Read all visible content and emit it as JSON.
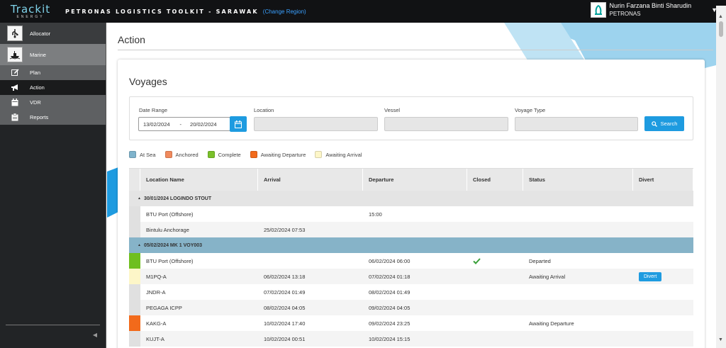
{
  "header": {
    "logo_main": "Trackit",
    "logo_sub": "ENERGY",
    "app_title": "PETRONAS LOGISTICS TOOLKIT - SARAWAK",
    "change_region": "(Change Region)",
    "user_name": "Nurin Farzana Binti Sharudin",
    "user_org": "PETRONAS"
  },
  "sidebar": {
    "items": [
      {
        "label": "Allocator",
        "icon": "usb-icon"
      },
      {
        "label": "Marine",
        "icon": "ship-icon"
      },
      {
        "label": "Plan",
        "icon": "edit-icon"
      },
      {
        "label": "Action",
        "icon": "megaphone-icon"
      },
      {
        "label": "VDR",
        "icon": "calendar-icon"
      },
      {
        "label": "Reports",
        "icon": "clipboard-icon"
      }
    ]
  },
  "page": {
    "title": "Action",
    "card_title": "Voyages"
  },
  "filters": {
    "date_range_label": "Date Range",
    "date_from": "13/02/2024",
    "date_sep": "-",
    "date_to": "20/02/2024",
    "location_label": "Location",
    "location_value": "",
    "vessel_label": "Vessel",
    "vessel_value": "",
    "voyage_type_label": "Voyage Type",
    "voyage_type_value": "",
    "search_label": "Search"
  },
  "legend": [
    {
      "label": "At Sea",
      "color": "#7fb3cc"
    },
    {
      "label": "Anchored",
      "color": "#f08a5d"
    },
    {
      "label": "Complete",
      "color": "#7ac02a"
    },
    {
      "label": "Awaiting Departure",
      "color": "#f26a1b"
    },
    {
      "label": "Awaiting Arrival",
      "color": "#fdf6c8"
    }
  ],
  "table": {
    "columns": [
      "Location Name",
      "Arrival",
      "Departure",
      "Closed",
      "Status",
      "Divert"
    ],
    "groups": [
      {
        "title": "30/01/2024 LOGINDO STOUT",
        "header_color": "#e4e4e4",
        "rows": [
          {
            "location": "BTU Port (Offshore)",
            "arrival": "",
            "departure": "15:00",
            "closed": false,
            "status": "",
            "divert": false,
            "indicator": "#e0e0e0"
          },
          {
            "location": "Bintulu Anchorage",
            "arrival": "25/02/2024 07:53",
            "departure": "",
            "closed": false,
            "status": "",
            "divert": false,
            "indicator": "#e0e0e0"
          }
        ]
      },
      {
        "title": "05/02/2024 MK 1 VOY003",
        "header_color": "#86b3c8",
        "rows": [
          {
            "location": "BTU Port (Offshore)",
            "arrival": "",
            "departure": "06/02/2024 06:00",
            "closed": true,
            "status": "Departed",
            "divert": false,
            "indicator": "#6fbf1f"
          },
          {
            "location": "M1PQ-A",
            "arrival": "06/02/2024 13:18",
            "departure": "07/02/2024 01:18",
            "closed": false,
            "status": "Awaiting Arrival",
            "divert": true,
            "indicator": "#fdf6c8"
          },
          {
            "location": "JNDR-A",
            "arrival": "07/02/2024 01:49",
            "departure": "08/02/2024 01:49",
            "closed": false,
            "status": "",
            "divert": false,
            "indicator": "#e0e0e0"
          },
          {
            "location": "PEGAGA ICPP",
            "arrival": "08/02/2024 04:05",
            "departure": "09/02/2024 04:05",
            "closed": false,
            "status": "",
            "divert": false,
            "indicator": "#e0e0e0"
          },
          {
            "location": "KAKG-A",
            "arrival": "10/02/2024 17:40",
            "departure": "09/02/2024 23:25",
            "closed": false,
            "status": "Awaiting Departure",
            "divert": false,
            "indicator": "#f26a1b"
          },
          {
            "location": "KUJT-A",
            "arrival": "10/02/2024 00:51",
            "departure": "10/02/2024 15:15",
            "closed": false,
            "status": "",
            "divert": false,
            "indicator": "#e0e0e0"
          }
        ]
      }
    ],
    "divert_label": "Divert"
  }
}
